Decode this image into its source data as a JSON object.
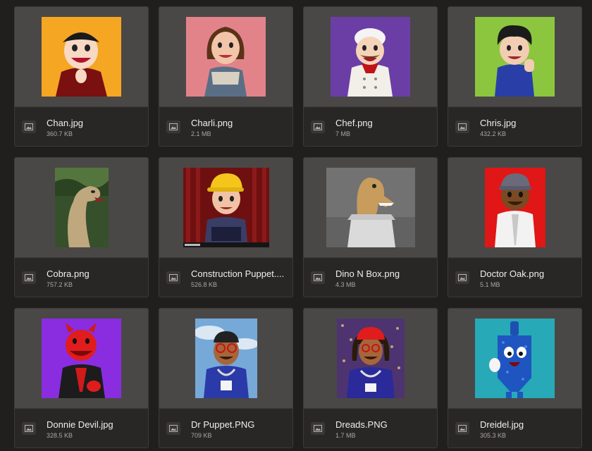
{
  "files": [
    {
      "name": "Chan.jpg",
      "size": "360.7 KB",
      "preview": "puppet-orange",
      "bg": "#f2a020"
    },
    {
      "name": "Charli.png",
      "size": "2.1 MB",
      "preview": "puppet-pink",
      "bg": "#e07f86"
    },
    {
      "name": "Chef.png",
      "size": "7 MB",
      "preview": "puppet-purple",
      "bg": "#6c3ea8"
    },
    {
      "name": "Chris.jpg",
      "size": "432.2 KB",
      "preview": "puppet-green",
      "bg": "#8dc63f"
    },
    {
      "name": "Cobra.png",
      "size": "757.2 KB",
      "preview": "cobra-jungle",
      "bg": "#3f5a2c"
    },
    {
      "name": "Construction Puppet....",
      "size": "526.8 KB",
      "preview": "puppet-curtain",
      "bg": "#7a1414"
    },
    {
      "name": "Dino N Box.png",
      "size": "4.3 MB",
      "preview": "dino-grey",
      "bg": "#6e6e6e"
    },
    {
      "name": "Doctor Oak.png",
      "size": "5.1 MB",
      "preview": "puppet-red",
      "bg": "#e01818"
    },
    {
      "name": "Donnie Devil.jpg",
      "size": "328.5 KB",
      "preview": "devil-purple",
      "bg": "#8a2fe0"
    },
    {
      "name": "Dr Puppet.PNG",
      "size": "709 KB",
      "preview": "puppet-sky",
      "bg": "#6fa6d8"
    },
    {
      "name": "Dreads.PNG",
      "size": "1.7 MB",
      "preview": "puppet-lights",
      "bg": "#5a3a7a"
    },
    {
      "name": "Dreidel.jpg",
      "size": "305.3 KB",
      "preview": "dreidel-teal",
      "bg": "#26a9b8"
    }
  ]
}
